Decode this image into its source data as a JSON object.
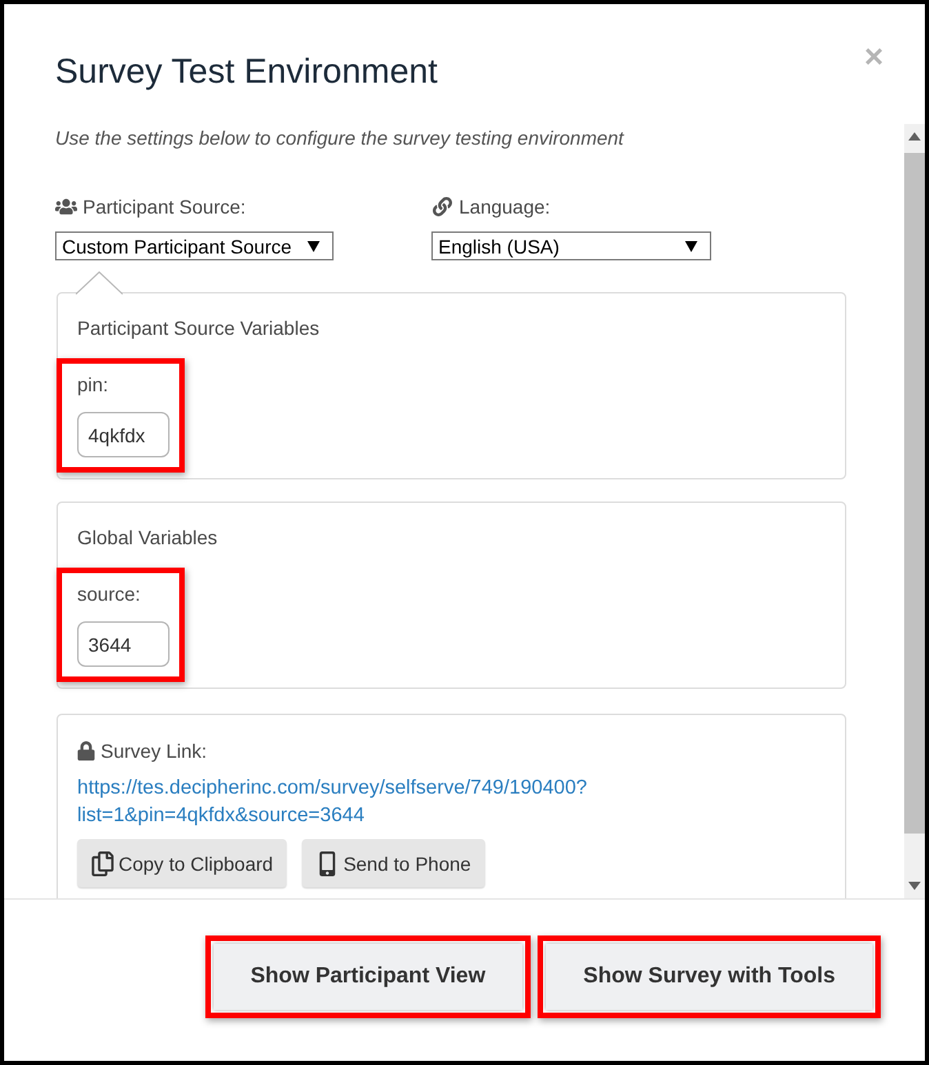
{
  "dialog": {
    "title": "Survey Test Environment",
    "close": "×"
  },
  "description": "Use the settings below to configure the survey testing environment",
  "selects": [
    {
      "label": "Participant Source:",
      "value": "Custom Participant Source"
    },
    {
      "label": "Language:",
      "value": "English (USA)"
    }
  ],
  "panels": [
    {
      "title": "Participant Source Variables",
      "fields": [
        {
          "label": "pin:",
          "value": "4qkfdx",
          "highlighted": true
        }
      ]
    },
    {
      "title": "Global Variables",
      "fields": [
        {
          "label": "source:",
          "value": "3644",
          "highlighted": true
        }
      ]
    }
  ],
  "survey_link": {
    "label": "Survey Link:",
    "url": "https://tes.decipherinc.com/survey/selfserve/749/190400?list=1&pin=4qkfdx&source=3644",
    "buttons": [
      {
        "label": "Copy to Clipboard"
      },
      {
        "label": "Send to Phone"
      }
    ]
  },
  "footer_buttons": [
    {
      "label": "Show Participant View",
      "highlighted": true
    },
    {
      "label": "Show Survey with Tools",
      "highlighted": true
    }
  ]
}
